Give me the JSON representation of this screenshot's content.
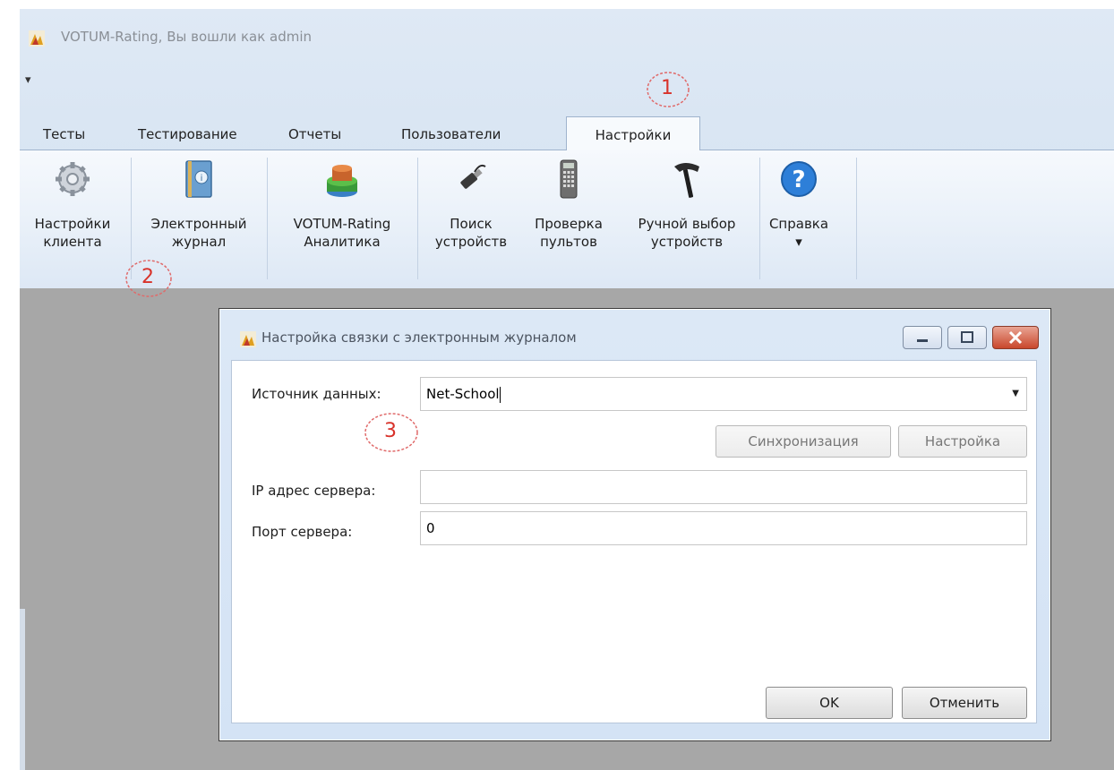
{
  "window": {
    "title": "VOTUM-Rating, Вы вошли как admin"
  },
  "qat": {
    "icon": "dropdown-arrow-icon",
    "glyph": "▾"
  },
  "tabs": [
    {
      "label": "Тесты",
      "active": false
    },
    {
      "label": "Тестирование",
      "active": false
    },
    {
      "label": "Отчеты",
      "active": false
    },
    {
      "label": "Пользователи",
      "active": false
    },
    {
      "label": "Настройки",
      "active": true
    }
  ],
  "ribbon": {
    "buttons": [
      {
        "label": "Настройки\nклиента",
        "icon": "gears-icon"
      },
      {
        "label": "Электронный\nжурнал",
        "icon": "journal-book-icon"
      },
      {
        "label": "VOTUM-Rating\nАналитика",
        "icon": "analytics-chart-icon"
      },
      {
        "label": "Поиск\nустройств",
        "icon": "usb-plug-icon"
      },
      {
        "label": "Проверка\nпультов",
        "icon": "remote-control-icon"
      },
      {
        "label": "Ручной выбор\nустройств",
        "icon": "hammer-icon"
      },
      {
        "label": "Справка\n▾",
        "icon": "help-question-icon"
      }
    ]
  },
  "annotations": [
    "1",
    "2",
    "3"
  ],
  "dialog": {
    "title": "Настройка связки с электронным журналом",
    "source_label": "Источник данных:",
    "source_value": "Net-School",
    "sync_button": "Синхронизация",
    "settings_button": "Настройка",
    "ip_label": "IP адрес сервера:",
    "ip_value": "",
    "port_label": "Порт сервера:",
    "port_value": "0",
    "ok_button": "OK",
    "cancel_button": "Отменить"
  },
  "colors": {
    "accent_annotation": "#d8322a",
    "close_button": "#c9472c",
    "ribbon_bg": "#dae6f3"
  }
}
